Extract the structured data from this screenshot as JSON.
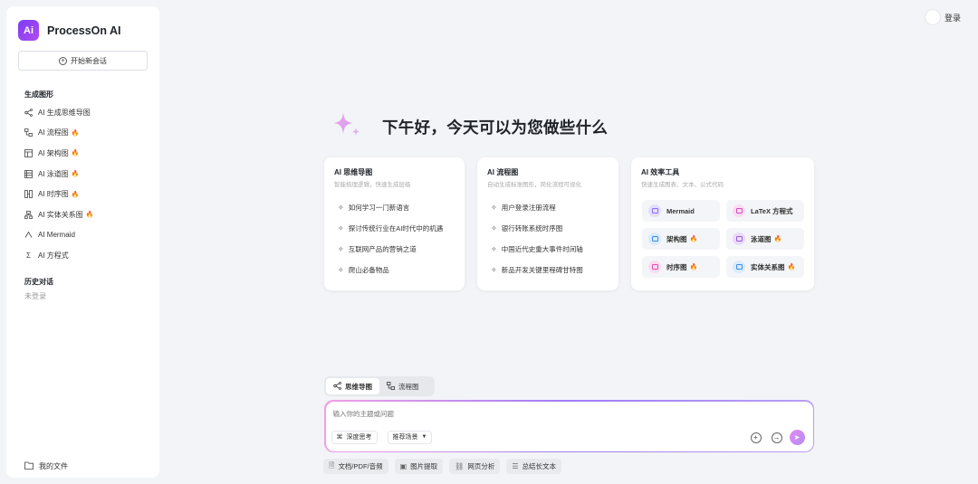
{
  "brand": {
    "logo_text": "Ai",
    "name": "ProcessOn AI"
  },
  "sidebar": {
    "new_chat_label": "开始新会话",
    "generate_section": "生成图形",
    "items": [
      {
        "label": "AI 生成思维导图",
        "icon": "mindmap-icon",
        "hot": false
      },
      {
        "label": "AI 流程图",
        "icon": "flowchart-icon",
        "hot": true
      },
      {
        "label": "AI 架构图",
        "icon": "architecture-icon",
        "hot": true
      },
      {
        "label": "AI 泳道图",
        "icon": "swimlane-icon",
        "hot": true
      },
      {
        "label": "AI 时序图",
        "icon": "sequence-icon",
        "hot": true
      },
      {
        "label": "AI 实体关系图",
        "icon": "entity-icon",
        "hot": true
      },
      {
        "label": "AI Mermaid",
        "icon": "mermaid-icon",
        "hot": false
      },
      {
        "label": "AI 方程式",
        "icon": "formula-icon",
        "hot": false
      }
    ],
    "history_section": "历史对话",
    "history_empty": "未登录",
    "my_files": "我的文件"
  },
  "header": {
    "login_label": "登录"
  },
  "greeting": "下午好，今天可以为您做些什么",
  "cards": {
    "mindmap": {
      "title": "AI 思维导图",
      "subtitle": "智能梳理逻辑，快速生成层级",
      "items": [
        "如何学习一门新语言",
        "探讨传统行业在AI时代中的机遇",
        "互联网产品的营销之道",
        "爬山必备物品"
      ]
    },
    "flow": {
      "title": "AI 流程图",
      "subtitle": "自动生成标准图形，简化流程可视化",
      "items": [
        "用户登录注册流程",
        "银行转账系统时序图",
        "中国近代史重大事件时间轴",
        "新品开发关键里程碑甘特图"
      ]
    },
    "tools": {
      "title": "AI 效率工具",
      "subtitle": "快速生成图表、文本、公式代码",
      "items": [
        {
          "label": "Mermaid",
          "color": "#8b6cf0",
          "bg": "#e4ddff",
          "hot": false
        },
        {
          "label": "LaTeX 方程式",
          "color": "#d64bb8",
          "bg": "#fbdcf1",
          "hot": false
        },
        {
          "label": "架构图",
          "color": "#3a8ee6",
          "bg": "#d9ebfc",
          "hot": true
        },
        {
          "label": "泳道图",
          "color": "#9b59d9",
          "bg": "#eadbfb",
          "hot": true
        },
        {
          "label": "时序图",
          "color": "#d94bb0",
          "bg": "#fbdcf1",
          "hot": true
        },
        {
          "label": "实体关系图",
          "color": "#3a8ee6",
          "bg": "#d9ebfc",
          "hot": true
        }
      ]
    }
  },
  "modes": {
    "mindmap_label": "思维导图",
    "flow_label": "流程图",
    "active": "mindmap"
  },
  "input": {
    "placeholder": "输入你的主题或问题",
    "deep_think_label": "深度思考",
    "scene_label": "推荐场景"
  },
  "bottom_tools": [
    "文档/PDF/音频",
    "图片提取",
    "网页分析",
    "总结长文本"
  ],
  "colors": {
    "accent": "#7b3cf5",
    "hot": "#f26a4b"
  }
}
